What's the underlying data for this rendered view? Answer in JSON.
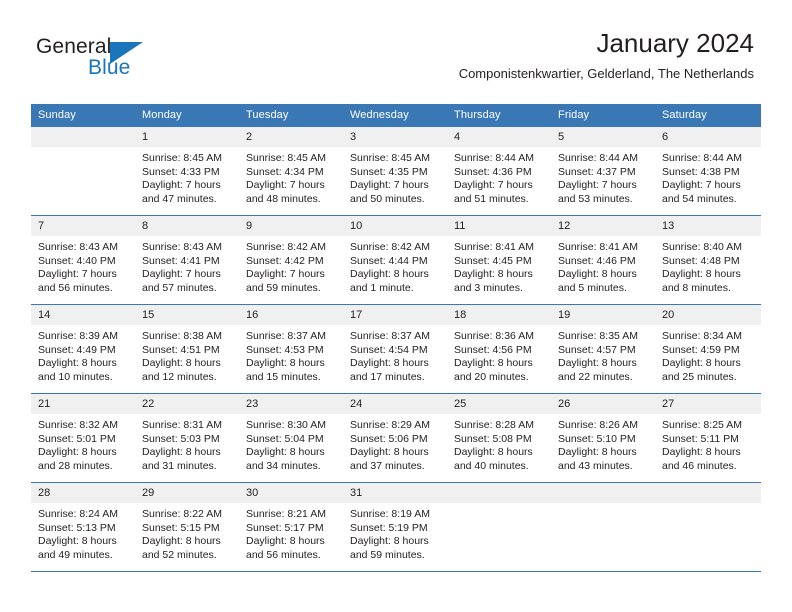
{
  "logo": {
    "word_top": "General",
    "word_bottom": "Blue",
    "triangle_color": "#1b75bb",
    "text_color": "#231f20"
  },
  "header": {
    "title": "January 2024",
    "subtitle": "Componistenkwartier, Gelderland, The Netherlands"
  },
  "colors": {
    "header_blue": "#3a77b5",
    "daynum_strip": "#f0f0f0",
    "text": "#231f20",
    "page_background": "#ffffff"
  },
  "calendar": {
    "weekday_headers": [
      "Sunday",
      "Monday",
      "Tuesday",
      "Wednesday",
      "Thursday",
      "Friday",
      "Saturday"
    ],
    "weeks": [
      [
        {
          "day": "",
          "sunrise": "",
          "sunset": "",
          "daylight_line1": "",
          "daylight_line2": ""
        },
        {
          "day": "1",
          "sunrise": "Sunrise: 8:45 AM",
          "sunset": "Sunset: 4:33 PM",
          "daylight_line1": "Daylight: 7 hours",
          "daylight_line2": "and 47 minutes."
        },
        {
          "day": "2",
          "sunrise": "Sunrise: 8:45 AM",
          "sunset": "Sunset: 4:34 PM",
          "daylight_line1": "Daylight: 7 hours",
          "daylight_line2": "and 48 minutes."
        },
        {
          "day": "3",
          "sunrise": "Sunrise: 8:45 AM",
          "sunset": "Sunset: 4:35 PM",
          "daylight_line1": "Daylight: 7 hours",
          "daylight_line2": "and 50 minutes."
        },
        {
          "day": "4",
          "sunrise": "Sunrise: 8:44 AM",
          "sunset": "Sunset: 4:36 PM",
          "daylight_line1": "Daylight: 7 hours",
          "daylight_line2": "and 51 minutes."
        },
        {
          "day": "5",
          "sunrise": "Sunrise: 8:44 AM",
          "sunset": "Sunset: 4:37 PM",
          "daylight_line1": "Daylight: 7 hours",
          "daylight_line2": "and 53 minutes."
        },
        {
          "day": "6",
          "sunrise": "Sunrise: 8:44 AM",
          "sunset": "Sunset: 4:38 PM",
          "daylight_line1": "Daylight: 7 hours",
          "daylight_line2": "and 54 minutes."
        }
      ],
      [
        {
          "day": "7",
          "sunrise": "Sunrise: 8:43 AM",
          "sunset": "Sunset: 4:40 PM",
          "daylight_line1": "Daylight: 7 hours",
          "daylight_line2": "and 56 minutes."
        },
        {
          "day": "8",
          "sunrise": "Sunrise: 8:43 AM",
          "sunset": "Sunset: 4:41 PM",
          "daylight_line1": "Daylight: 7 hours",
          "daylight_line2": "and 57 minutes."
        },
        {
          "day": "9",
          "sunrise": "Sunrise: 8:42 AM",
          "sunset": "Sunset: 4:42 PM",
          "daylight_line1": "Daylight: 7 hours",
          "daylight_line2": "and 59 minutes."
        },
        {
          "day": "10",
          "sunrise": "Sunrise: 8:42 AM",
          "sunset": "Sunset: 4:44 PM",
          "daylight_line1": "Daylight: 8 hours",
          "daylight_line2": "and 1 minute."
        },
        {
          "day": "11",
          "sunrise": "Sunrise: 8:41 AM",
          "sunset": "Sunset: 4:45 PM",
          "daylight_line1": "Daylight: 8 hours",
          "daylight_line2": "and 3 minutes."
        },
        {
          "day": "12",
          "sunrise": "Sunrise: 8:41 AM",
          "sunset": "Sunset: 4:46 PM",
          "daylight_line1": "Daylight: 8 hours",
          "daylight_line2": "and 5 minutes."
        },
        {
          "day": "13",
          "sunrise": "Sunrise: 8:40 AM",
          "sunset": "Sunset: 4:48 PM",
          "daylight_line1": "Daylight: 8 hours",
          "daylight_line2": "and 8 minutes."
        }
      ],
      [
        {
          "day": "14",
          "sunrise": "Sunrise: 8:39 AM",
          "sunset": "Sunset: 4:49 PM",
          "daylight_line1": "Daylight: 8 hours",
          "daylight_line2": "and 10 minutes."
        },
        {
          "day": "15",
          "sunrise": "Sunrise: 8:38 AM",
          "sunset": "Sunset: 4:51 PM",
          "daylight_line1": "Daylight: 8 hours",
          "daylight_line2": "and 12 minutes."
        },
        {
          "day": "16",
          "sunrise": "Sunrise: 8:37 AM",
          "sunset": "Sunset: 4:53 PM",
          "daylight_line1": "Daylight: 8 hours",
          "daylight_line2": "and 15 minutes."
        },
        {
          "day": "17",
          "sunrise": "Sunrise: 8:37 AM",
          "sunset": "Sunset: 4:54 PM",
          "daylight_line1": "Daylight: 8 hours",
          "daylight_line2": "and 17 minutes."
        },
        {
          "day": "18",
          "sunrise": "Sunrise: 8:36 AM",
          "sunset": "Sunset: 4:56 PM",
          "daylight_line1": "Daylight: 8 hours",
          "daylight_line2": "and 20 minutes."
        },
        {
          "day": "19",
          "sunrise": "Sunrise: 8:35 AM",
          "sunset": "Sunset: 4:57 PM",
          "daylight_line1": "Daylight: 8 hours",
          "daylight_line2": "and 22 minutes."
        },
        {
          "day": "20",
          "sunrise": "Sunrise: 8:34 AM",
          "sunset": "Sunset: 4:59 PM",
          "daylight_line1": "Daylight: 8 hours",
          "daylight_line2": "and 25 minutes."
        }
      ],
      [
        {
          "day": "21",
          "sunrise": "Sunrise: 8:32 AM",
          "sunset": "Sunset: 5:01 PM",
          "daylight_line1": "Daylight: 8 hours",
          "daylight_line2": "and 28 minutes."
        },
        {
          "day": "22",
          "sunrise": "Sunrise: 8:31 AM",
          "sunset": "Sunset: 5:03 PM",
          "daylight_line1": "Daylight: 8 hours",
          "daylight_line2": "and 31 minutes."
        },
        {
          "day": "23",
          "sunrise": "Sunrise: 8:30 AM",
          "sunset": "Sunset: 5:04 PM",
          "daylight_line1": "Daylight: 8 hours",
          "daylight_line2": "and 34 minutes."
        },
        {
          "day": "24",
          "sunrise": "Sunrise: 8:29 AM",
          "sunset": "Sunset: 5:06 PM",
          "daylight_line1": "Daylight: 8 hours",
          "daylight_line2": "and 37 minutes."
        },
        {
          "day": "25",
          "sunrise": "Sunrise: 8:28 AM",
          "sunset": "Sunset: 5:08 PM",
          "daylight_line1": "Daylight: 8 hours",
          "daylight_line2": "and 40 minutes."
        },
        {
          "day": "26",
          "sunrise": "Sunrise: 8:26 AM",
          "sunset": "Sunset: 5:10 PM",
          "daylight_line1": "Daylight: 8 hours",
          "daylight_line2": "and 43 minutes."
        },
        {
          "day": "27",
          "sunrise": "Sunrise: 8:25 AM",
          "sunset": "Sunset: 5:11 PM",
          "daylight_line1": "Daylight: 8 hours",
          "daylight_line2": "and 46 minutes."
        }
      ],
      [
        {
          "day": "28",
          "sunrise": "Sunrise: 8:24 AM",
          "sunset": "Sunset: 5:13 PM",
          "daylight_line1": "Daylight: 8 hours",
          "daylight_line2": "and 49 minutes."
        },
        {
          "day": "29",
          "sunrise": "Sunrise: 8:22 AM",
          "sunset": "Sunset: 5:15 PM",
          "daylight_line1": "Daylight: 8 hours",
          "daylight_line2": "and 52 minutes."
        },
        {
          "day": "30",
          "sunrise": "Sunrise: 8:21 AM",
          "sunset": "Sunset: 5:17 PM",
          "daylight_line1": "Daylight: 8 hours",
          "daylight_line2": "and 56 minutes."
        },
        {
          "day": "31",
          "sunrise": "Sunrise: 8:19 AM",
          "sunset": "Sunset: 5:19 PM",
          "daylight_line1": "Daylight: 8 hours",
          "daylight_line2": "and 59 minutes."
        },
        {
          "day": "",
          "sunrise": "",
          "sunset": "",
          "daylight_line1": "",
          "daylight_line2": ""
        },
        {
          "day": "",
          "sunrise": "",
          "sunset": "",
          "daylight_line1": "",
          "daylight_line2": ""
        },
        {
          "day": "",
          "sunrise": "",
          "sunset": "",
          "daylight_line1": "",
          "daylight_line2": ""
        }
      ]
    ]
  }
}
